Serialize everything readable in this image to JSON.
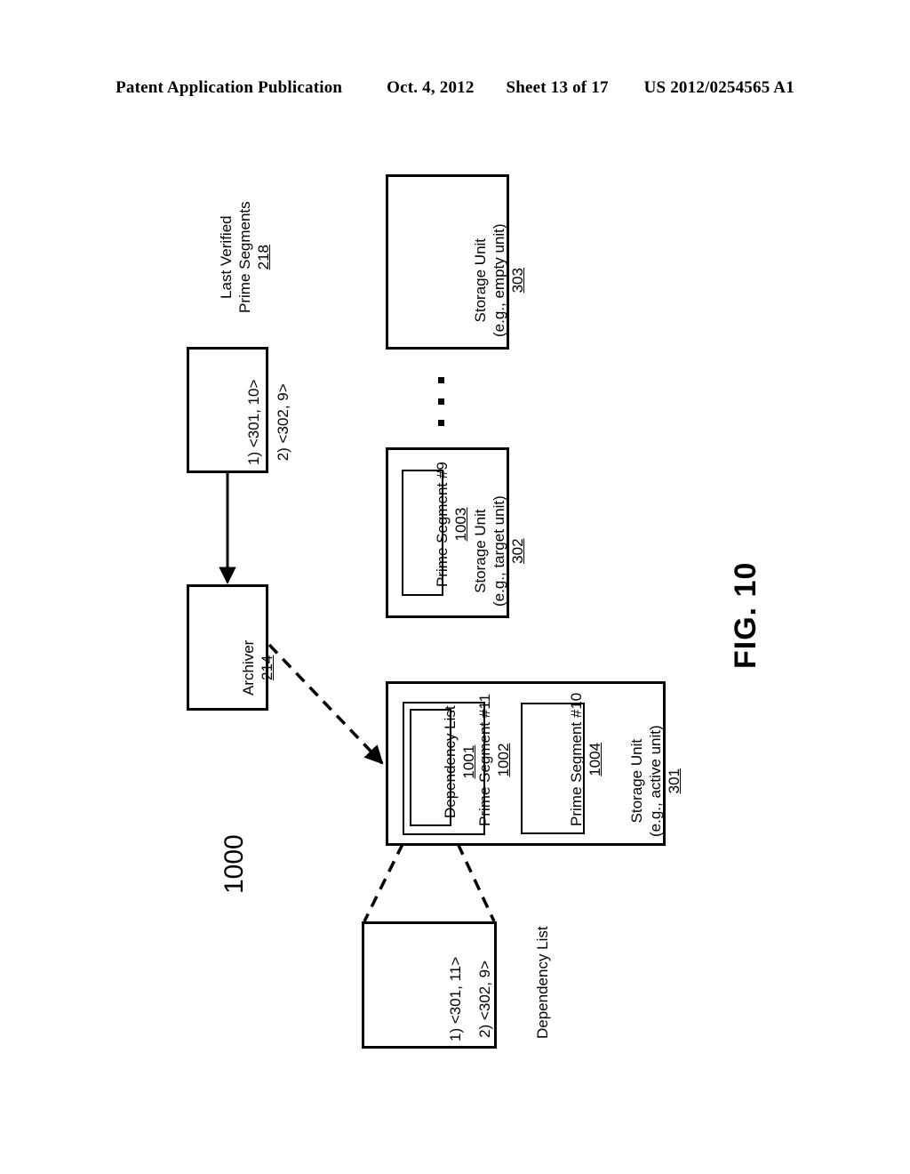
{
  "header": {
    "publication": "Patent Application Publication",
    "date": "Oct. 4, 2012",
    "sheet": "Sheet 13 of 17",
    "number": "US 2012/0254565 A1"
  },
  "figure": {
    "label": "FIG. 10",
    "diagram_numeral": "1000"
  },
  "nodes": {
    "last_verified_label": {
      "line1": "Last Verified",
      "line2": "Prime Segments",
      "numeral": "218"
    },
    "last_verified_box": {
      "entry1": "1) <301, 10>",
      "entry2": "2) <302, 9>"
    },
    "archiver": {
      "title": "Archiver",
      "numeral": "214"
    },
    "storage_unit_303": {
      "line1": "Storage Unit",
      "line2": "(e.g., empty unit)",
      "numeral": "303"
    },
    "storage_unit_302": {
      "line1": "Storage Unit",
      "line2": "(e.g., target unit)",
      "numeral": "302"
    },
    "prime_segment_9": {
      "title": "Prime Segment #9",
      "numeral": "1003"
    },
    "storage_unit_301": {
      "line1": "Storage Unit",
      "line2": "(e.g., active unit)",
      "numeral": "301"
    },
    "prime_segment_11": {
      "title": "Prime Segment #11",
      "numeral": "1002"
    },
    "dependency_list_1001": {
      "title": "Dependency List",
      "numeral": "1001"
    },
    "prime_segment_10": {
      "title": "Prime Segment #10",
      "numeral": "1004"
    },
    "dependency_list_detail": {
      "caption": "Dependency List",
      "entry1": "1) <301, 11>",
      "entry2": "2) <302, 9>"
    }
  },
  "colors": {
    "ink": "#000000",
    "paper": "#ffffff"
  }
}
